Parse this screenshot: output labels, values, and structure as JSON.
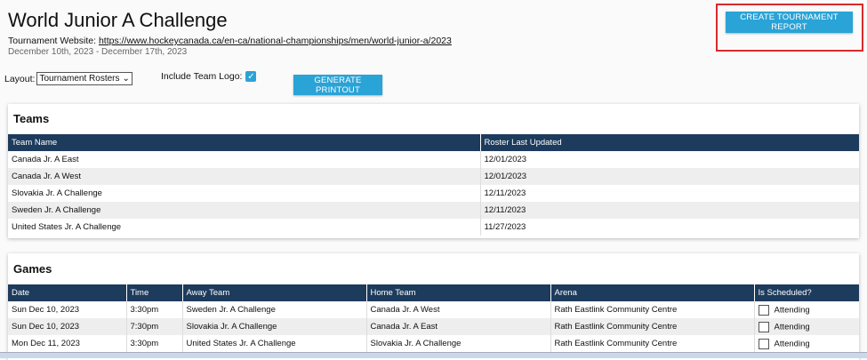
{
  "header": {
    "title": "World Junior A Challenge",
    "website_label": "Tournament Website:",
    "website_url": "https://www.hockeycanada.ca/en-ca/national-championships/men/world-junior-a/2023",
    "dates": "December 10th, 2023 - December 17th, 2023",
    "report_button": "CREATE TOURNAMENT REPORT"
  },
  "controls": {
    "layout_label": "Layout:",
    "layout_value": "Tournament Rosters",
    "logo_label": "Include Team Logo:",
    "print_button": "GENERATE PRINTOUT"
  },
  "teams": {
    "title": "Teams",
    "headers": [
      "Team Name",
      "Roster Last Updated"
    ],
    "rows": [
      [
        "Canada Jr. A East",
        "12/01/2023"
      ],
      [
        "Canada Jr. A West",
        "12/01/2023"
      ],
      [
        "Slovakia Jr. A Challenge",
        "12/11/2023"
      ],
      [
        "Sweden Jr. A Challenge",
        "12/11/2023"
      ],
      [
        "United States Jr. A Challenge",
        "11/27/2023"
      ]
    ]
  },
  "games": {
    "title": "Games",
    "headers": [
      "Date",
      "Time",
      "Away Team",
      "Home Team",
      "Arena",
      "Is Scheduled?"
    ],
    "rows": [
      [
        "Sun Dec 10, 2023",
        "3:30pm",
        "Sweden Jr. A Challenge",
        "Canada Jr. A West",
        "Rath Eastlink Community Centre",
        "Attending"
      ],
      [
        "Sun Dec 10, 2023",
        "7:30pm",
        "Slovakia Jr. A Challenge",
        "Canada Jr. A East",
        "Rath Eastlink Community Centre",
        "Attending"
      ],
      [
        "Mon Dec 11, 2023",
        "3:30pm",
        "United States Jr. A Challenge",
        "Slovakia Jr. A Challenge",
        "Rath Eastlink Community Centre",
        "Attending"
      ]
    ]
  }
}
